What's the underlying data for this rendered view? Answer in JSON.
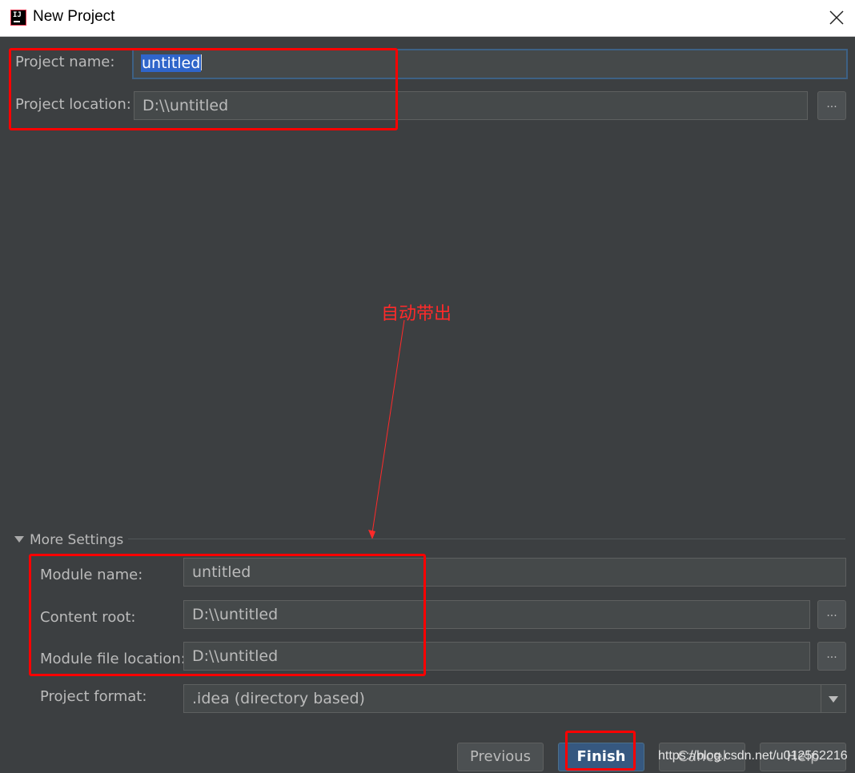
{
  "window": {
    "title": "New Project",
    "icon": "intellij-idea-icon",
    "icon_text": "IJ"
  },
  "project": {
    "name_label": "Project name:",
    "name_value": "untitled",
    "location_label": "Project location:",
    "location_value": "D:\\\\untitled",
    "browse_label": "..."
  },
  "annotation": {
    "text": "自动带出",
    "color": "#ff2a2a"
  },
  "more_settings": {
    "toggle_label": "More Settings",
    "module_name_label": "Module name:",
    "module_name_value": "untitled",
    "content_root_label": "Content root:",
    "content_root_value": "D:\\\\untitled",
    "module_file_label": "Module file location:",
    "module_file_value": "D:\\\\untitled",
    "browse_label": "...",
    "format_label": "Project format:",
    "format_value": ".idea (directory based)"
  },
  "buttons": {
    "previous": "Previous",
    "finish": "Finish",
    "cancel": "Cancel",
    "help": "Help"
  },
  "watermark": "https://blog.csdn.net/u012562216",
  "colors": {
    "background": "#3c3f41",
    "field": "#45494a",
    "focus_border": "#3d6185",
    "selection": "#2f65ca",
    "highlight_red": "#ff0000",
    "default_button": "#365880"
  }
}
